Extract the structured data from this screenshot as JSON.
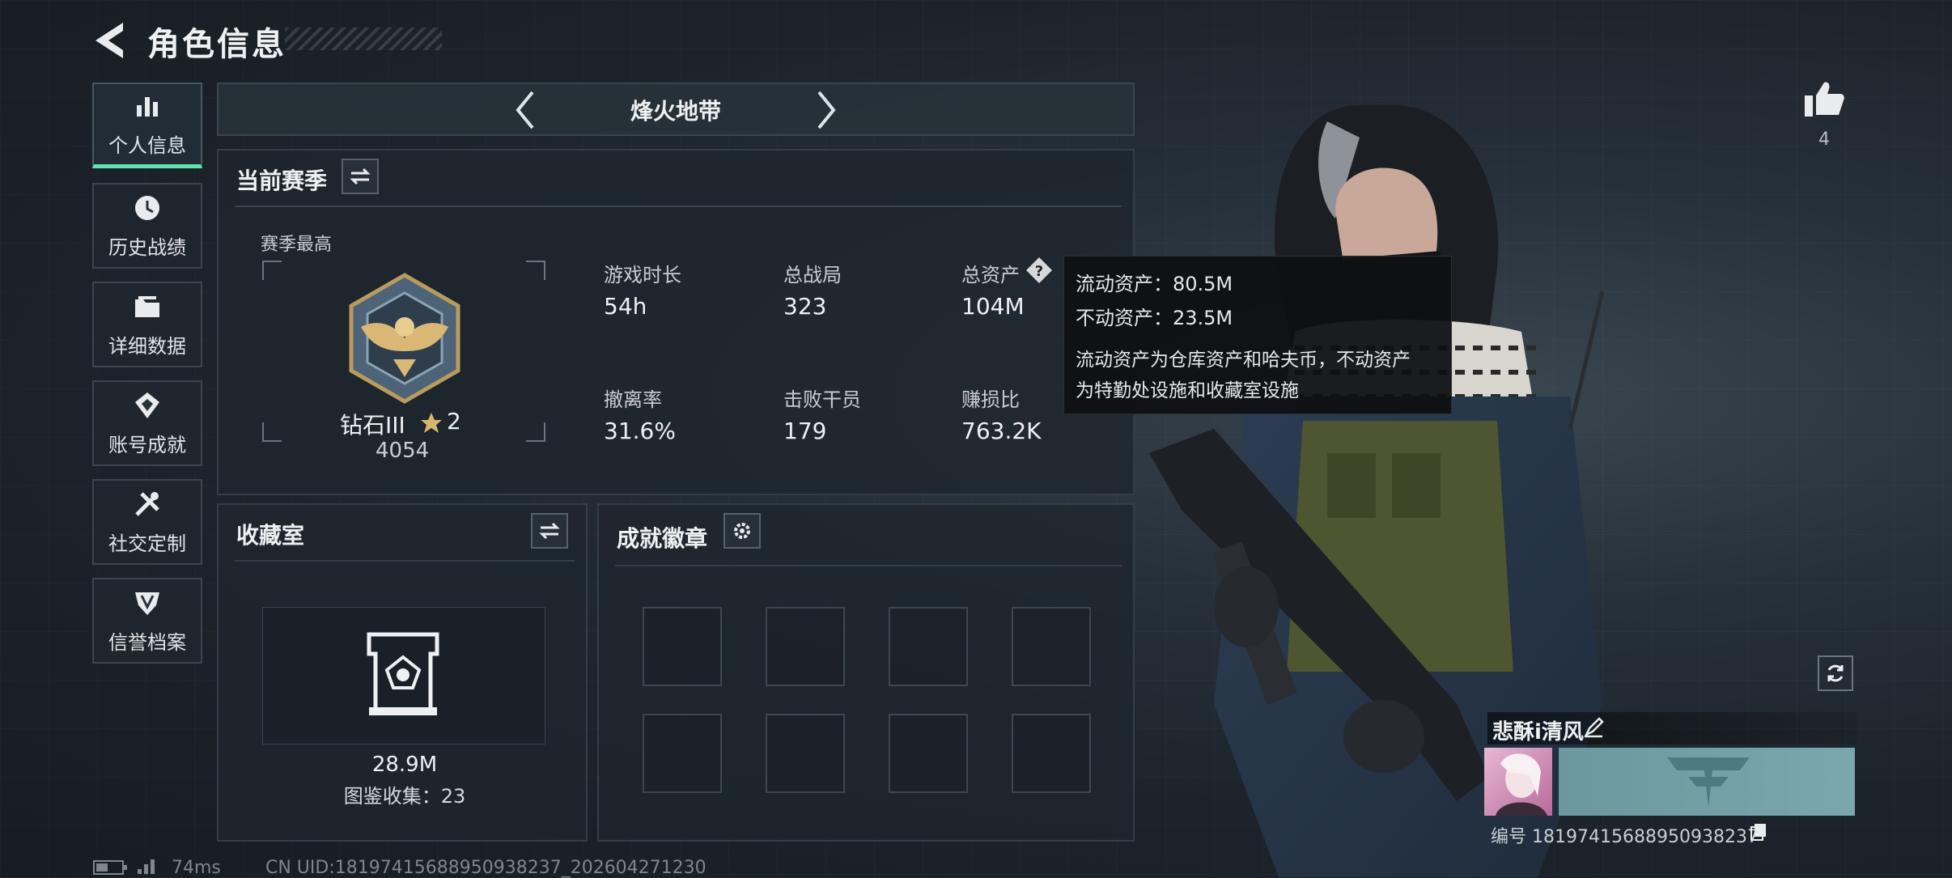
{
  "header": {
    "title": "角色信息"
  },
  "nav": [
    {
      "label": "个人信息",
      "icon": "bar-chart-icon"
    },
    {
      "label": "历史战绩",
      "icon": "history-icon"
    },
    {
      "label": "详细数据",
      "icon": "folder-icon"
    },
    {
      "label": "账号成就",
      "icon": "achievement-icon"
    },
    {
      "label": "社交定制",
      "icon": "tools-icon"
    },
    {
      "label": "信誉档案",
      "icon": "shield-icon"
    }
  ],
  "mode_selector": {
    "label": "烽火地带"
  },
  "season": {
    "title": "当前赛季",
    "best_label": "赛季最高",
    "rank_name": "钻石III",
    "rank_stars": "2",
    "rank_score": "4054",
    "stats": [
      {
        "label": "游戏时长",
        "value": "54h"
      },
      {
        "label": "总战局",
        "value": "323"
      },
      {
        "label": "总资产",
        "value": "104M"
      },
      {
        "label": "撤离率",
        "value": "31.6%"
      },
      {
        "label": "击败干员",
        "value": "179"
      },
      {
        "label": "赚损比",
        "value": "763.2K"
      }
    ]
  },
  "tooltip": {
    "line1": "流动资产：80.5M",
    "line2": "不动资产：23.5M",
    "line3": "流动资产为仓库资产和哈夫币，不动资产",
    "line4": "为特勤处设施和收藏室设施"
  },
  "collection": {
    "title": "收藏室",
    "value": "28.9M",
    "caption": "图鉴收集：23"
  },
  "badges": {
    "title": "成就徽章",
    "slot_count": 8
  },
  "likes": {
    "count": "4"
  },
  "player": {
    "name": "悲酥i清风",
    "id_text": "编号 18197415688950938237"
  },
  "footer": {
    "ping": "74ms",
    "uid": "CN UID:18197415688950938237_202604271230"
  },
  "colors": {
    "accent": "#5fe3b0",
    "background": "#1b2229",
    "panel": "#1e262d",
    "card": "#6f9aa0"
  }
}
